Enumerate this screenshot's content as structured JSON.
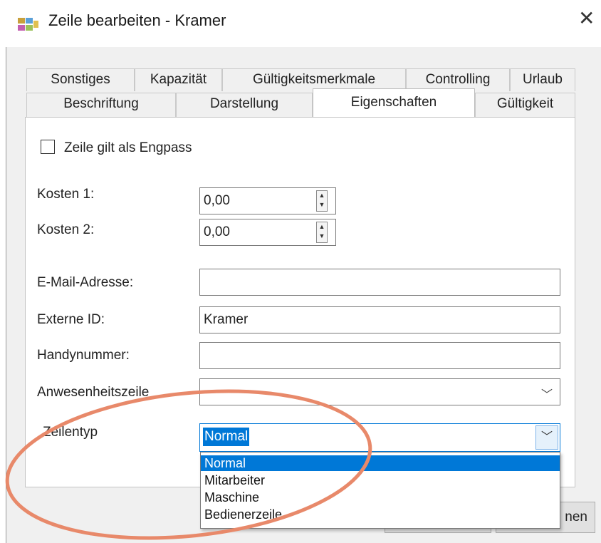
{
  "window": {
    "title": "Zeile  bearbeiten - Kramer",
    "close": "✕"
  },
  "tabs_row1": [
    "Sonstiges",
    "Kapazität",
    "Gültigkeitsmerkmale",
    "Controlling",
    "Urlaub"
  ],
  "tabs_row2": [
    "Beschriftung",
    "Darstellung",
    "Eigenschaften",
    "Gültigkeit"
  ],
  "active_tab": "Eigenschaften",
  "checkbox": {
    "label": "Zeile gilt als Engpass",
    "checked": false
  },
  "fields": {
    "kosten1": {
      "label": "Kosten 1:",
      "value": "0,00"
    },
    "kosten2": {
      "label": "Kosten 2:",
      "value": "0,00"
    },
    "email": {
      "label": "E-Mail-Adresse:",
      "value": ""
    },
    "externe_id": {
      "label": "Externe ID:",
      "value": "Kramer"
    },
    "handy": {
      "label": "Handynummer:",
      "value": ""
    },
    "anwesenheit": {
      "label": "Anwesenheitszeile",
      "value": "-"
    },
    "zeilentyp": {
      "label": "Zeilentyp",
      "value": "Normal"
    }
  },
  "zeilentyp_options": [
    "Normal",
    "Mitarbeiter",
    "Maschine",
    "Bedienerzeile"
  ],
  "buttons": {
    "partial": "nen"
  },
  "colors": {
    "highlight": "#0078d7",
    "annotation": "#e8896a"
  }
}
